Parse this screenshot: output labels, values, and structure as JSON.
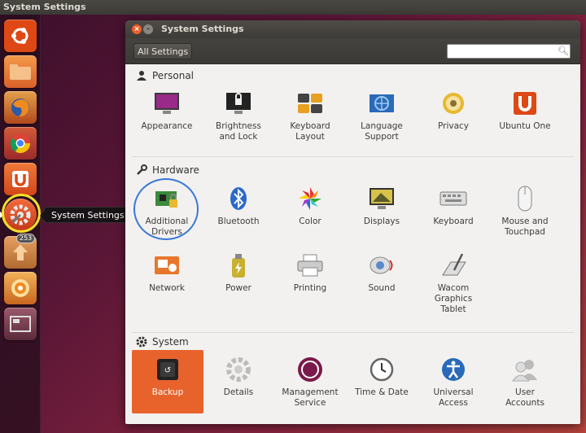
{
  "top_panel": {
    "title": "System Settings"
  },
  "launcher": {
    "tooltip": "System Settings",
    "badge": "253",
    "items": [
      {
        "icon": "ubuntu-logo-icon",
        "color": "#dd4814"
      },
      {
        "icon": "files-icon",
        "color": "#e8762b"
      },
      {
        "icon": "firefox-icon",
        "color": "#c65a1e"
      },
      {
        "icon": "chrome-icon",
        "color": "#b23a3a"
      },
      {
        "icon": "ubuntu-one-icon",
        "color": "#dd4814"
      },
      {
        "icon": "system-settings-icon",
        "color": "#c0c0c0"
      },
      {
        "icon": "update-manager-icon",
        "color": "#c07a3a"
      },
      {
        "icon": "disk-icon",
        "color": "#e08a2a"
      },
      {
        "icon": "workspace-icon",
        "color": "#7a3f4c"
      }
    ]
  },
  "window": {
    "title": "System Settings",
    "all_settings": "All Settings",
    "search": {
      "value": "",
      "placeholder": ""
    }
  },
  "sections": {
    "personal": {
      "title": "Personal",
      "items": [
        {
          "label": "Appearance"
        },
        {
          "label": "Brightness\nand Lock"
        },
        {
          "label": "Keyboard\nLayout"
        },
        {
          "label": "Language\nSupport"
        },
        {
          "label": "Privacy"
        },
        {
          "label": "Ubuntu One"
        }
      ]
    },
    "hardware": {
      "title": "Hardware",
      "items": [
        {
          "label": "Additional\nDrivers"
        },
        {
          "label": "Bluetooth"
        },
        {
          "label": "Color"
        },
        {
          "label": "Displays"
        },
        {
          "label": "Keyboard"
        },
        {
          "label": "Mouse and\nTouchpad"
        },
        {
          "label": "Network"
        },
        {
          "label": "Power"
        },
        {
          "label": "Printing"
        },
        {
          "label": "Sound"
        },
        {
          "label": "Wacom\nGraphics\nTablet"
        }
      ]
    },
    "system": {
      "title": "System",
      "items": [
        {
          "label": "Backup"
        },
        {
          "label": "Details"
        },
        {
          "label": "Management\nService"
        },
        {
          "label": "Time & Date"
        },
        {
          "label": "Universal\nAccess"
        },
        {
          "label": "User\nAccounts"
        }
      ]
    }
  },
  "colors": {
    "accent": "#e8632c",
    "highlight_ring": "#f2e12a",
    "drivers_ring": "#3a78d4"
  }
}
